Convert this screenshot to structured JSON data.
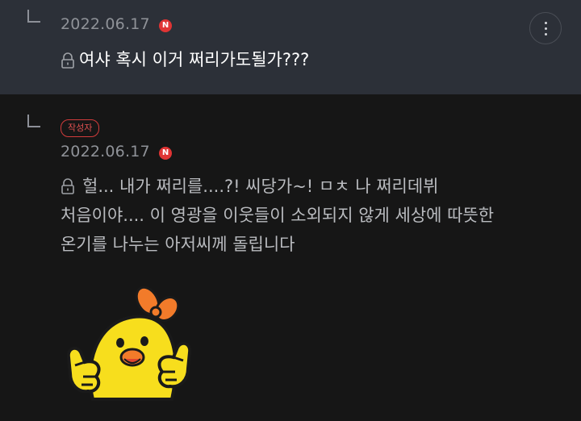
{
  "replies": [
    {
      "date": "2022.06.17",
      "new_badge": "N",
      "text": "여샤 혹시 이거 쩌리가도될가???",
      "more_icon": "more-vertical-icon"
    },
    {
      "author_badge": "작성자",
      "date": "2022.06.17",
      "new_badge": "N",
      "text": "헐... 내가 쩌리를....?! 씨당가~! ㅁㅊ 나 쩌리데뷔\n처음이야.... 이 영광을 이웃들이 소외되지 않게 세상에 따뜻한\n온기를 나누는 아저씨께 돌립니다",
      "sticker": "yellow-chick-thumbs-up-sticker"
    }
  ],
  "colors": {
    "reply1_bg": "#2c3038",
    "reply2_bg": "#161616",
    "accent_red": "#e03434",
    "sticker_yellow": "#f7de1d"
  }
}
